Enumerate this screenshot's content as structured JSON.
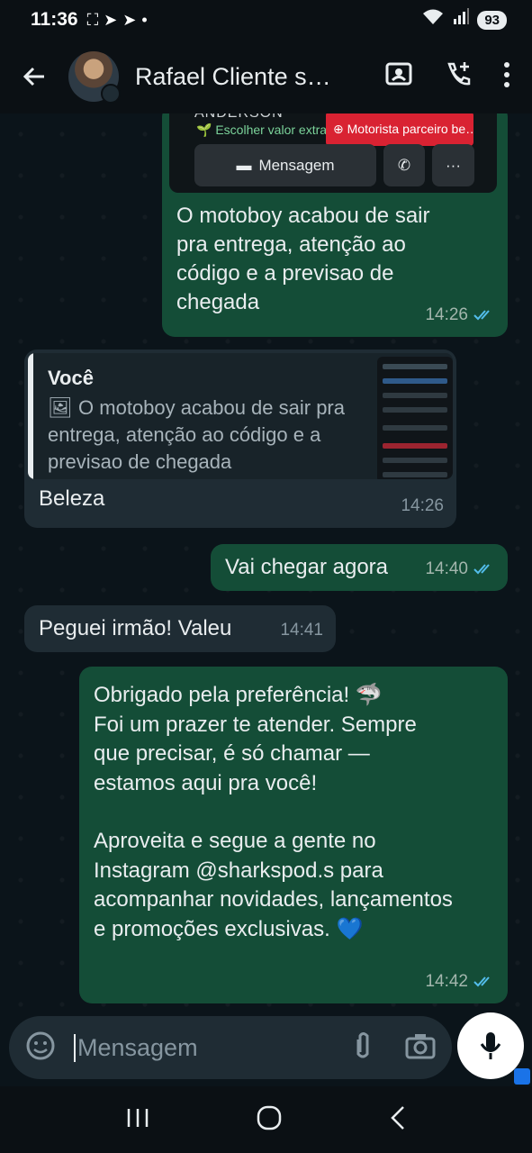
{
  "status_bar": {
    "time": "11:36",
    "battery": "93"
  },
  "header": {
    "contact_name": "Rafael Cliente s…"
  },
  "card": {
    "name": "ANDERSON",
    "extra_value": "Escolher valor extra",
    "partner_tag": "Motorista parceiro be…",
    "message_button": "Mensagem"
  },
  "messages": [
    {
      "id": "m1",
      "direction": "out",
      "text": "O motoboy acabou de sair pra entrega, atenção ao código e a previsao de chegada",
      "time": "14:26"
    },
    {
      "id": "m2",
      "direction": "in",
      "quote_author": "Você",
      "quote_text": "O motoboy acabou de sair pra entrega, atenção ao código e a previsao de chegada",
      "text": "Beleza",
      "time": "14:26"
    },
    {
      "id": "m3",
      "direction": "out",
      "text": "Vai chegar agora",
      "time": "14:40"
    },
    {
      "id": "m4",
      "direction": "in",
      "text": "Peguei irmão! Valeu",
      "time": "14:41"
    },
    {
      "id": "m5",
      "direction": "out",
      "lines": [
        "Obrigado pela preferência! 🦈",
        "Foi um prazer te atender. Sempre que precisar, é só chamar — estamos aqui pra você!",
        "",
        "Aproveita e segue a gente no Instagram @sharkspod.s para acompanhar novidades, lançamentos e promoções exclusivas. 💙"
      ],
      "time": "14:42"
    }
  ],
  "input": {
    "placeholder": "Mensagem"
  },
  "colors": {
    "outgoing": "#144d37",
    "incoming": "#1f2c34",
    "read_ticks": "#53bdeb"
  }
}
